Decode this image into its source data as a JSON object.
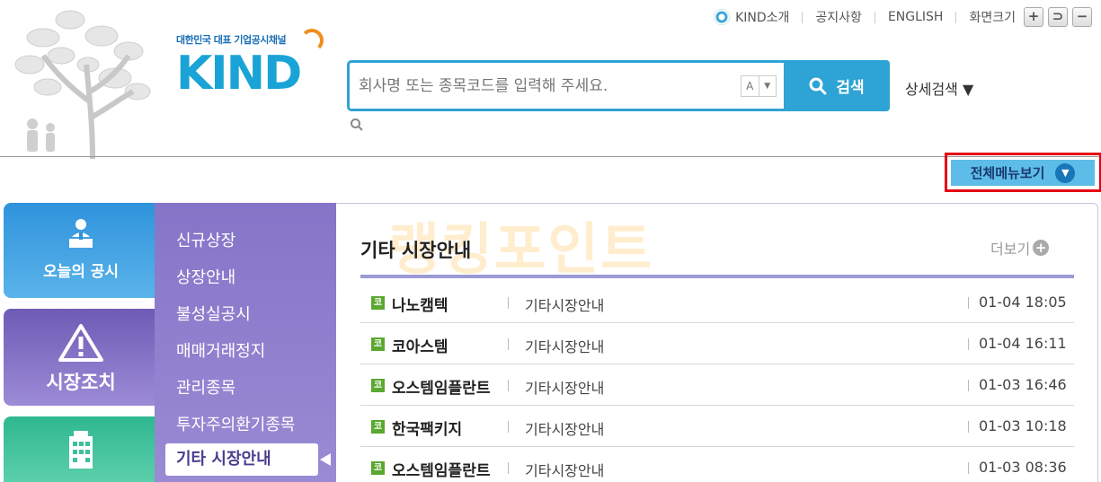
{
  "utility": {
    "kind_intro": "KIND소개",
    "notice": "공지사항",
    "english": "ENGLISH",
    "screen_size": "화면크기",
    "zoom_in": "+",
    "zoom_reset": "⊃",
    "zoom_out": "−"
  },
  "logo": {
    "tagline": "대한민국 대표 기업공시채널",
    "wordmark": "KIND"
  },
  "search": {
    "placeholder": "회사명 또는 종목코드를 입력해 주세요.",
    "font_toggle": "A",
    "font_arrow": "▼",
    "button_label": "검색",
    "advanced_label": "상세검색 ▼"
  },
  "full_menu_label": "전체메뉴보기",
  "big_tabs": [
    {
      "label": "오늘의 공시"
    },
    {
      "label": "시장조치"
    },
    {
      "label": ""
    }
  ],
  "submenu": {
    "items": [
      "신규상장",
      "상장안내",
      "불성실공시",
      "매매거래정지",
      "관리종목",
      "투자주의환기종목"
    ],
    "active": "기타 시장안내"
  },
  "panel": {
    "title": "기타 시장안내",
    "more_label": "더보기",
    "watermark": "랭킹포인트",
    "rows": [
      {
        "badge": "코",
        "company": "나노캠텍",
        "category": "기타시장안내",
        "time": "01-04 18:05"
      },
      {
        "badge": "코",
        "company": "코아스템",
        "category": "기타시장안내",
        "time": "01-04 16:11"
      },
      {
        "badge": "코",
        "company": "오스템임플란트",
        "category": "기타시장안내",
        "time": "01-03 16:46"
      },
      {
        "badge": "코",
        "company": "한국팩키지",
        "category": "기타시장안내",
        "time": "01-03 10:18"
      },
      {
        "badge": "코",
        "company": "오스템임플란트",
        "category": "기타시장안내",
        "time": "01-03 08:36"
      }
    ]
  },
  "colors": {
    "accent_blue": "#2ea3d5",
    "menu_purple": "#8575c8",
    "highlight_red": "#e60012",
    "badge_green": "#5aa830"
  }
}
